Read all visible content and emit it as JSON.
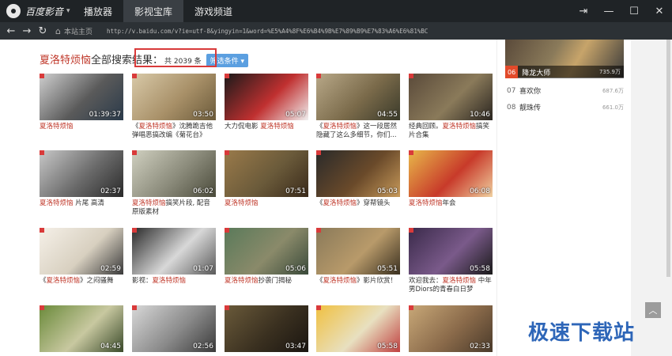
{
  "app": {
    "name": "百度影音",
    "tabs": [
      "播放器",
      "影视宝库",
      "游戏频道"
    ],
    "active_tab": 1
  },
  "window_controls": {
    "pin": "⇥",
    "minimize": "—",
    "maximize": "☐",
    "close": "✕"
  },
  "address": {
    "home_label": "本站主页",
    "url": "http://v.baidu.com/v?ie=utf-8&yingyin=1&word=%E5%A4%8F%E6%B4%9B%E7%89%B9%E7%83%A6%E6%81%BC"
  },
  "search": {
    "query": "夏洛特烦恼",
    "results_label": "全部搜索结果：",
    "count_text": "共 2039 条",
    "filter_label": "筛选条件"
  },
  "videos": [
    {
      "duration": "01:39:37",
      "title_parts": [
        {
          "t": "夏洛特烦恼",
          "h": true
        }
      ],
      "colors": [
        "#cfcfcf",
        "#5a5a5a",
        "#2a3a4a"
      ]
    },
    {
      "duration": "03:50",
      "title_parts": [
        {
          "t": "《",
          "h": false
        },
        {
          "t": "夏洛特烦恼",
          "h": true
        },
        {
          "t": "》沈腾跪吉他弹唱恶搞改编《菊花台》",
          "h": false
        }
      ],
      "colors": [
        "#d8c9a8",
        "#a89068",
        "#6b5a3a"
      ]
    },
    {
      "duration": "05:07",
      "title_parts": [
        {
          "t": "大力侃电影 ",
          "h": false
        },
        {
          "t": "夏洛特烦恼",
          "h": true
        }
      ],
      "colors": [
        "#1a1a1a",
        "#c03030",
        "#f0f0f0"
      ]
    },
    {
      "duration": "04:55",
      "title_parts": [
        {
          "t": "《",
          "h": false
        },
        {
          "t": "夏洛特烦恼",
          "h": true
        },
        {
          "t": "》这一段居然隐藏了这么多细节，你们...",
          "h": false
        }
      ],
      "colors": [
        "#b8a888",
        "#7a6a4a",
        "#3a3a2a"
      ]
    },
    {
      "duration": "10:46",
      "title_parts": [
        {
          "t": "经典回顾。",
          "h": false
        },
        {
          "t": "夏洛特烦恼",
          "h": true
        },
        {
          "t": "搞笑片合集",
          "h": false
        }
      ],
      "colors": [
        "#5a4a3a",
        "#8a7a5a",
        "#2a2520"
      ]
    },
    {
      "duration": "02:37",
      "title_parts": [
        {
          "t": "夏洛特烦恼",
          "h": true
        },
        {
          "t": " 片尾 高清",
          "h": false
        }
      ],
      "colors": [
        "#c8c8c8",
        "#6a6a6a",
        "#2a2a2a"
      ]
    },
    {
      "duration": "06:02",
      "title_parts": [
        {
          "t": "夏洛特烦恼",
          "h": true
        },
        {
          "t": "搞笑片段, 配音原版素材",
          "h": false
        }
      ],
      "colors": [
        "#d0d0c0",
        "#8a8a7a",
        "#4a4a3a"
      ]
    },
    {
      "duration": "07:51",
      "title_parts": [
        {
          "t": "夏洛特烦恼",
          "h": true
        }
      ],
      "colors": [
        "#9a7a4a",
        "#6a5a3a",
        "#3a2a1a"
      ]
    },
    {
      "duration": "05:03",
      "title_parts": [
        {
          "t": "《",
          "h": false
        },
        {
          "t": "夏洛特烦恼",
          "h": true
        },
        {
          "t": "》穿帮镜头",
          "h": false
        }
      ],
      "colors": [
        "#2a2a2a",
        "#6a4a2a",
        "#c89a5a"
      ]
    },
    {
      "duration": "06:08",
      "title_parts": [
        {
          "t": "夏洛特烦恼",
          "h": true
        },
        {
          "t": "年会",
          "h": false
        }
      ],
      "colors": [
        "#e8b84a",
        "#c83a2a",
        "#f0d0a0"
      ]
    },
    {
      "duration": "02:59",
      "title_parts": [
        {
          "t": "《",
          "h": false
        },
        {
          "t": "夏洛特烦恼",
          "h": true
        },
        {
          "t": "》之闷骚舞",
          "h": false
        }
      ],
      "colors": [
        "#f5f0e8",
        "#d8d0c0",
        "#3a3a3a"
      ]
    },
    {
      "duration": "01:07",
      "title_parts": [
        {
          "t": "影视：",
          "h": false
        },
        {
          "t": "夏洛特烦恼",
          "h": true
        }
      ],
      "colors": [
        "#2a2a2a",
        "#d8d8d8",
        "#5a5a5a"
      ]
    },
    {
      "duration": "05:06",
      "title_parts": [
        {
          "t": "夏洛特烦恼",
          "h": true
        },
        {
          "t": "抄袭门揭秘",
          "h": false
        }
      ],
      "colors": [
        "#5a7a5a",
        "#8a8a6a",
        "#3a4a3a"
      ]
    },
    {
      "duration": "05:51",
      "title_parts": [
        {
          "t": "《",
          "h": false
        },
        {
          "t": "夏洛特烦恼",
          "h": true
        },
        {
          "t": "》影片欣赏！",
          "h": false
        }
      ],
      "colors": [
        "#8a7a5a",
        "#b89a6a",
        "#3a3020"
      ]
    },
    {
      "duration": "05:58",
      "title_parts": [
        {
          "t": "欢迎我去：",
          "h": false
        },
        {
          "t": "夏洛特烦恼",
          "h": true
        },
        {
          "t": " 中年男Diors的青春白日梦",
          "h": false
        }
      ],
      "colors": [
        "#3a2a4a",
        "#7a5a8a",
        "#1a1a1a"
      ]
    },
    {
      "duration": "04:45",
      "title_parts": [],
      "colors": [
        "#6a8a3a",
        "#c8c8a0",
        "#3a4a2a"
      ]
    },
    {
      "duration": "02:56",
      "title_parts": [],
      "colors": [
        "#d8d8d8",
        "#8a8a8a",
        "#3a3a3a"
      ]
    },
    {
      "duration": "03:47",
      "title_parts": [],
      "colors": [
        "#6a5a3a",
        "#3a3020",
        "#1a1510"
      ]
    },
    {
      "duration": "05:58",
      "title_parts": [],
      "colors": [
        "#f0c040",
        "#e8e0c0",
        "#c04040"
      ]
    },
    {
      "duration": "02:33",
      "title_parts": [],
      "colors": [
        "#c8a878",
        "#8a6a4a",
        "#4a3a2a"
      ]
    }
  ],
  "sidebar": {
    "top": {
      "rank": "06",
      "title": "降龙大师",
      "score": "735.9万"
    },
    "items": [
      {
        "rank": "07",
        "title": "喜欢你",
        "score": "687.6万"
      },
      {
        "rank": "08",
        "title": "靓珠传",
        "score": "661.0万"
      }
    ]
  },
  "back_to_top": "︿",
  "watermark": "极速下载站"
}
